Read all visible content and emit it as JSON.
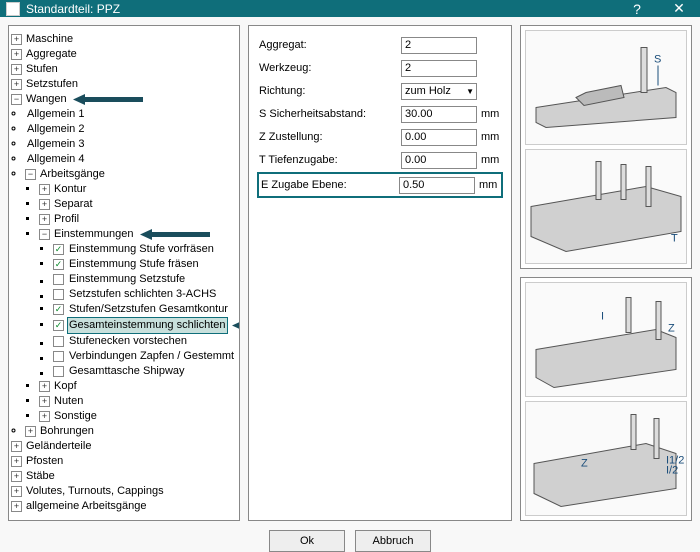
{
  "titlebar": {
    "title": "Standardteil: PPZ"
  },
  "tree": {
    "maschine": "Maschine",
    "aggregate": "Aggregate",
    "stufen": "Stufen",
    "setzstufen": "Setzstufen",
    "wangen": "Wangen",
    "allg1": "Allgemein  1",
    "allg2": "Allgemein  2",
    "allg3": "Allgemein  3",
    "allg4": "Allgemein  4",
    "arbeitsgaenge": "Arbeitsgänge",
    "kontur": "Kontur",
    "separat": "Separat",
    "profil": "Profil",
    "einstemmungen": "Einstemmungen",
    "sub1": "Einstemmung Stufe vorfräsen",
    "sub2": "Einstemmung Stufe fräsen",
    "sub3": "Einstemmung Setzstufe",
    "sub4": "Setzstufen schlichten 3-ACHS",
    "sub5": "Stufen/Setzstufen Gesamtkontur",
    "sub6": "Gesamteinstemmung schlichten",
    "sub7": "Stufenecken vorstechen",
    "sub8": "Verbindungen Zapfen / Gestemmt",
    "sub9": "Gesamttasche Shipway",
    "kopf": "Kopf",
    "nuten": "Nuten",
    "sonstige": "Sonstige",
    "bohrungen": "Bohrungen",
    "gelaender": "Geländerteile",
    "pfosten": "Pfosten",
    "staebe": "Stäbe",
    "volutes": "Volutes, Turnouts, Cappings",
    "allgArbeit": "allgemeine Arbeitsgänge"
  },
  "form": {
    "aggregat_label": "Aggregat:",
    "aggregat_value": "2",
    "werkzeug_label": "Werkzeug:",
    "werkzeug_value": "2",
    "richtung_label": "Richtung:",
    "richtung_value": "zum Holz",
    "sicher_label": "S Sicherheitsabstand:",
    "sicher_value": "30.00",
    "zustell_label": "Z Zustellung:",
    "zustell_value": "0.00",
    "tiefen_label": "T Tiefenzugabe:",
    "tiefen_value": "0.00",
    "ebene_label": "E Zugabe Ebene:",
    "ebene_value": "0.50",
    "mm": "mm"
  },
  "buttons": {
    "ok": "Ok",
    "cancel": "Abbruch"
  }
}
